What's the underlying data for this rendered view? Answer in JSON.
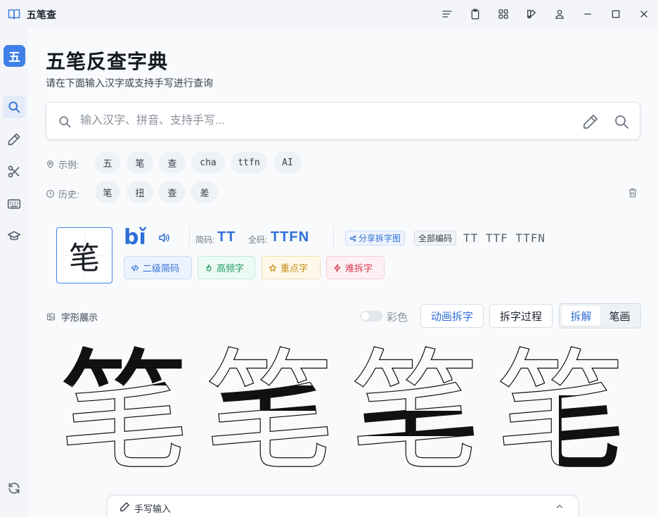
{
  "window": {
    "title": "五笔查"
  },
  "sidebar": {
    "logo_text": "五",
    "items": [
      {
        "name": "search",
        "icon": "search-icon",
        "active": true
      },
      {
        "name": "handwrite",
        "icon": "pencil-icon"
      },
      {
        "name": "split",
        "icon": "scissors-icon"
      },
      {
        "name": "keyboard",
        "icon": "keyboard-icon"
      },
      {
        "name": "learn",
        "icon": "graduation-cap-icon"
      }
    ],
    "bottom_icon": "refresh-icon"
  },
  "header": {
    "title": "五笔反查字典",
    "subtitle": "请在下面输入汉字或支持手写进行查询"
  },
  "search": {
    "placeholder": "输入汉字、拼音、支持手写...",
    "value": ""
  },
  "examples": {
    "label": "示例:",
    "items": [
      "五",
      "笔",
      "查",
      "cha",
      "ttfn",
      "AI"
    ]
  },
  "history": {
    "label": "历史:",
    "items": [
      "笔",
      "扭",
      "查",
      "差"
    ]
  },
  "result": {
    "character": "笔",
    "pinyin": "bǐ",
    "jianma_label": "简码:",
    "jianma_value": "TT",
    "quanma_label": "全码:",
    "quanma_value": "TTFN",
    "share_label": "分享拆字图",
    "all_codes_label": "全部编码",
    "all_codes": "TT  TTF  TTFN",
    "badges": [
      {
        "label": "二级简码",
        "icon": "code-icon"
      },
      {
        "label": "高频字",
        "icon": "flame-icon"
      },
      {
        "label": "重点字",
        "icon": "star-icon"
      },
      {
        "label": "难拆字",
        "icon": "bolt-icon"
      }
    ]
  },
  "glyph_display": {
    "label": "字形展示",
    "color_label": "彩色",
    "color_on": false,
    "animate_label": "动画拆字",
    "process_label": "拆字过程",
    "modes": [
      "拆解",
      "笔画"
    ],
    "active_mode": "拆解",
    "glyph": "笔"
  },
  "handwriting": {
    "label": "手写输入"
  },
  "colors": {
    "accent": "#2f6fd8",
    "brand": "#3e7fe8"
  }
}
